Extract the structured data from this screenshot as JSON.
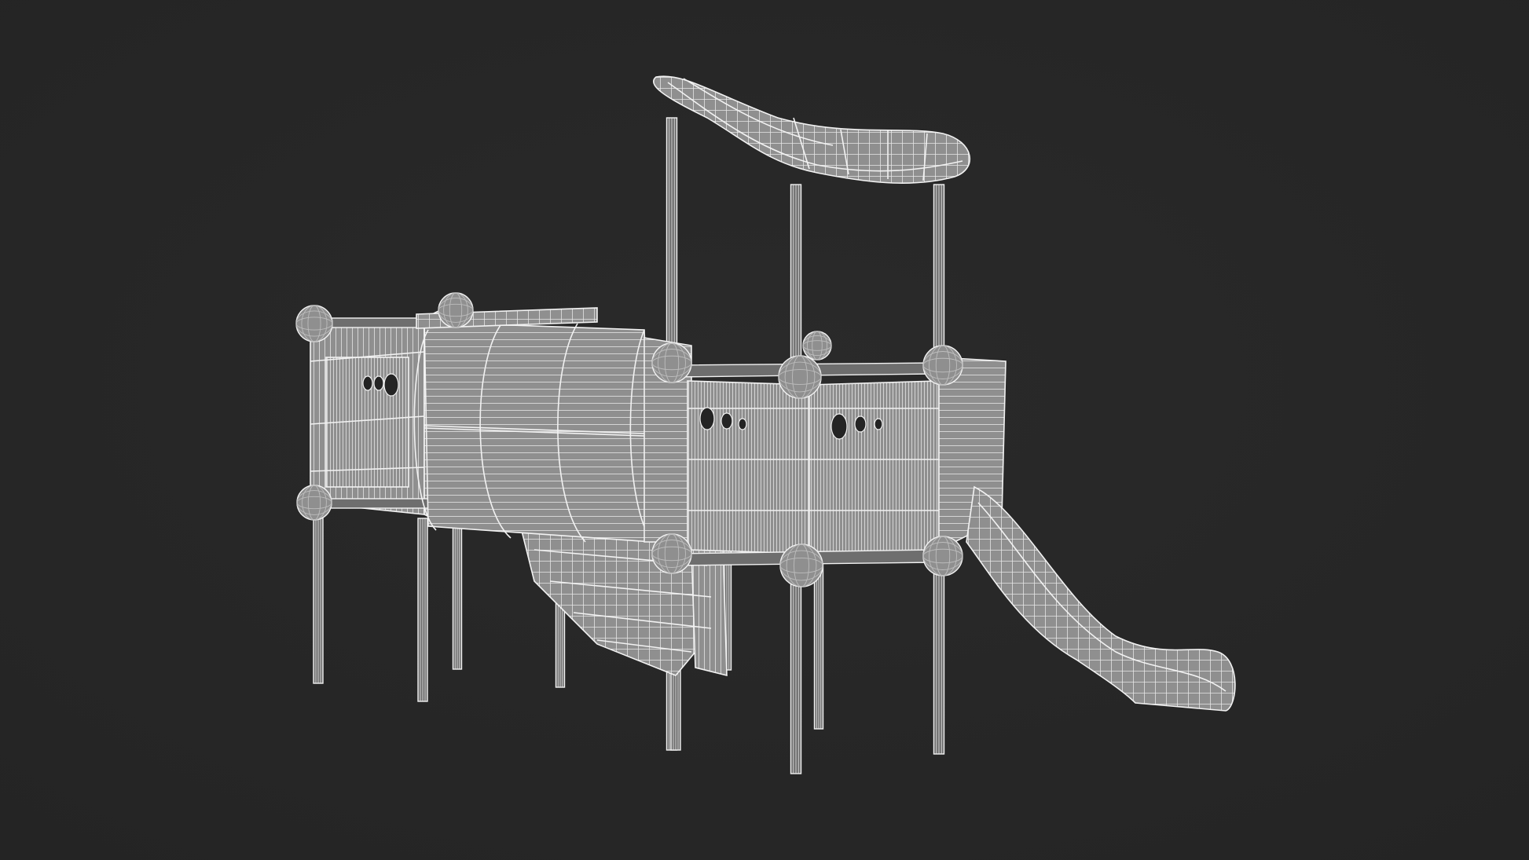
{
  "render": {
    "subject": "playground-tower-wireframe",
    "background_color": "#2a2a2a",
    "vignette_color": "#242424",
    "surface_color": "#8f8f8f",
    "surface_shade_color": "#6e6e6e",
    "wire_color": "#e6e6e6",
    "wire_dim_color": "#bdbdbd",
    "outline_color": "#f2f2f2"
  }
}
